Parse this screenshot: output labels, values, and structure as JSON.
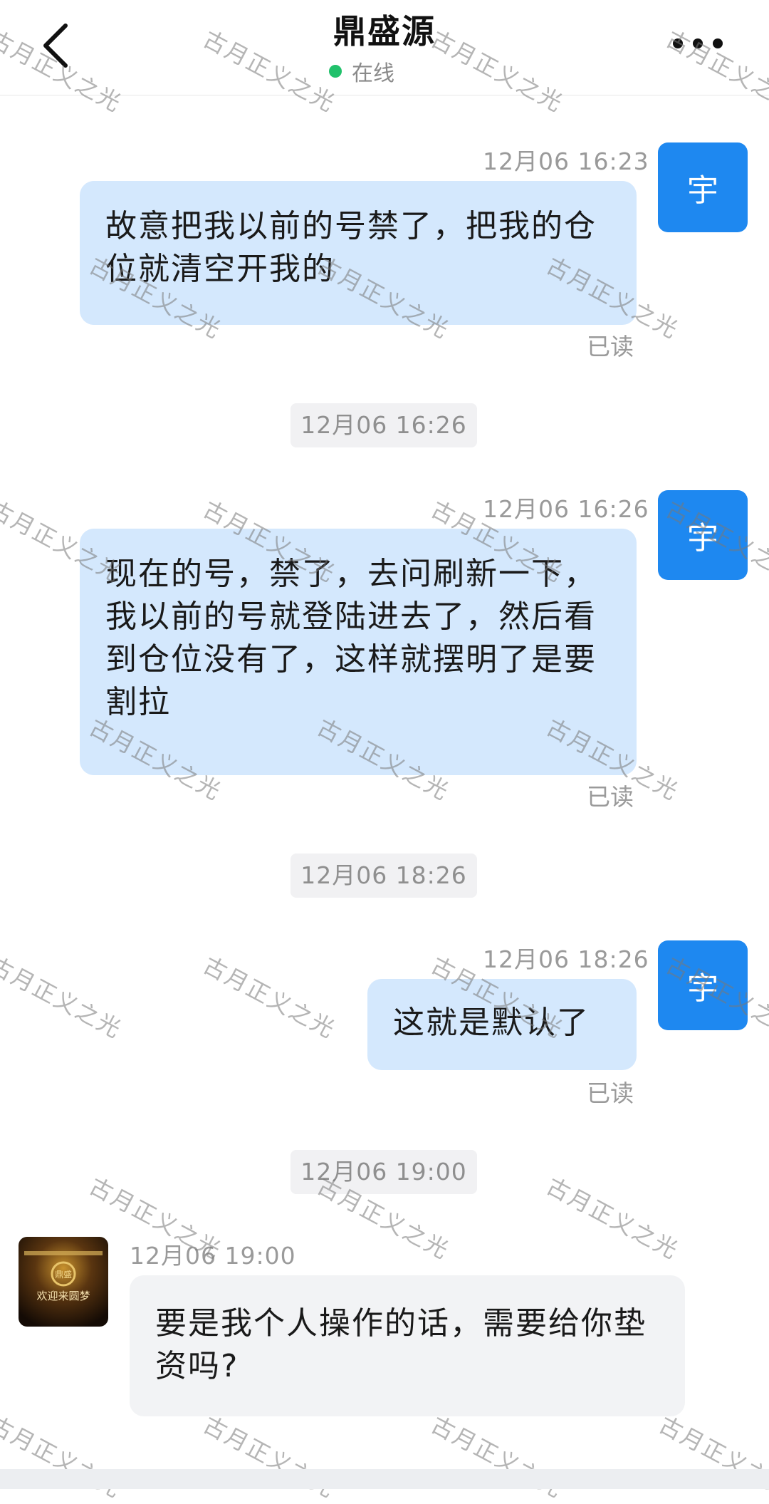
{
  "header": {
    "title": "鼎盛源",
    "status": "在线"
  },
  "messages": [
    {
      "time": "12月06 16:23",
      "text": "故意把我以前的号禁了，把我的仓位就清空开我的",
      "read": "已读",
      "avatar": "宇"
    },
    {
      "separator": "12月06 16:26",
      "time": "12月06 16:26",
      "text": "现在的号，禁了，去问刷新一下，我以前的号就登陆进去了，然后看到仓位没有了，这样就摆明了是要割拉",
      "read": "已读",
      "avatar": "宇"
    },
    {
      "separator": "12月06 18:26",
      "time": "12月06 18:26",
      "text": "这就是默认了",
      "read": "已读",
      "avatar": "宇"
    },
    {
      "separator": "12月06 19:00",
      "time": "12月06 19:00",
      "text": "要是我个人操作的话，需要给你垫资吗?"
    }
  ],
  "avatar_them": {
    "logo_text": "鼎盛",
    "tagline": "欢迎来圆梦"
  },
  "watermark": "古月正义之光",
  "colors": {
    "mine_bubble": "#d4e8fd",
    "their_bubble": "#f2f3f5",
    "avatar_blue": "#1e88f0",
    "online_dot": "#21c16b"
  }
}
